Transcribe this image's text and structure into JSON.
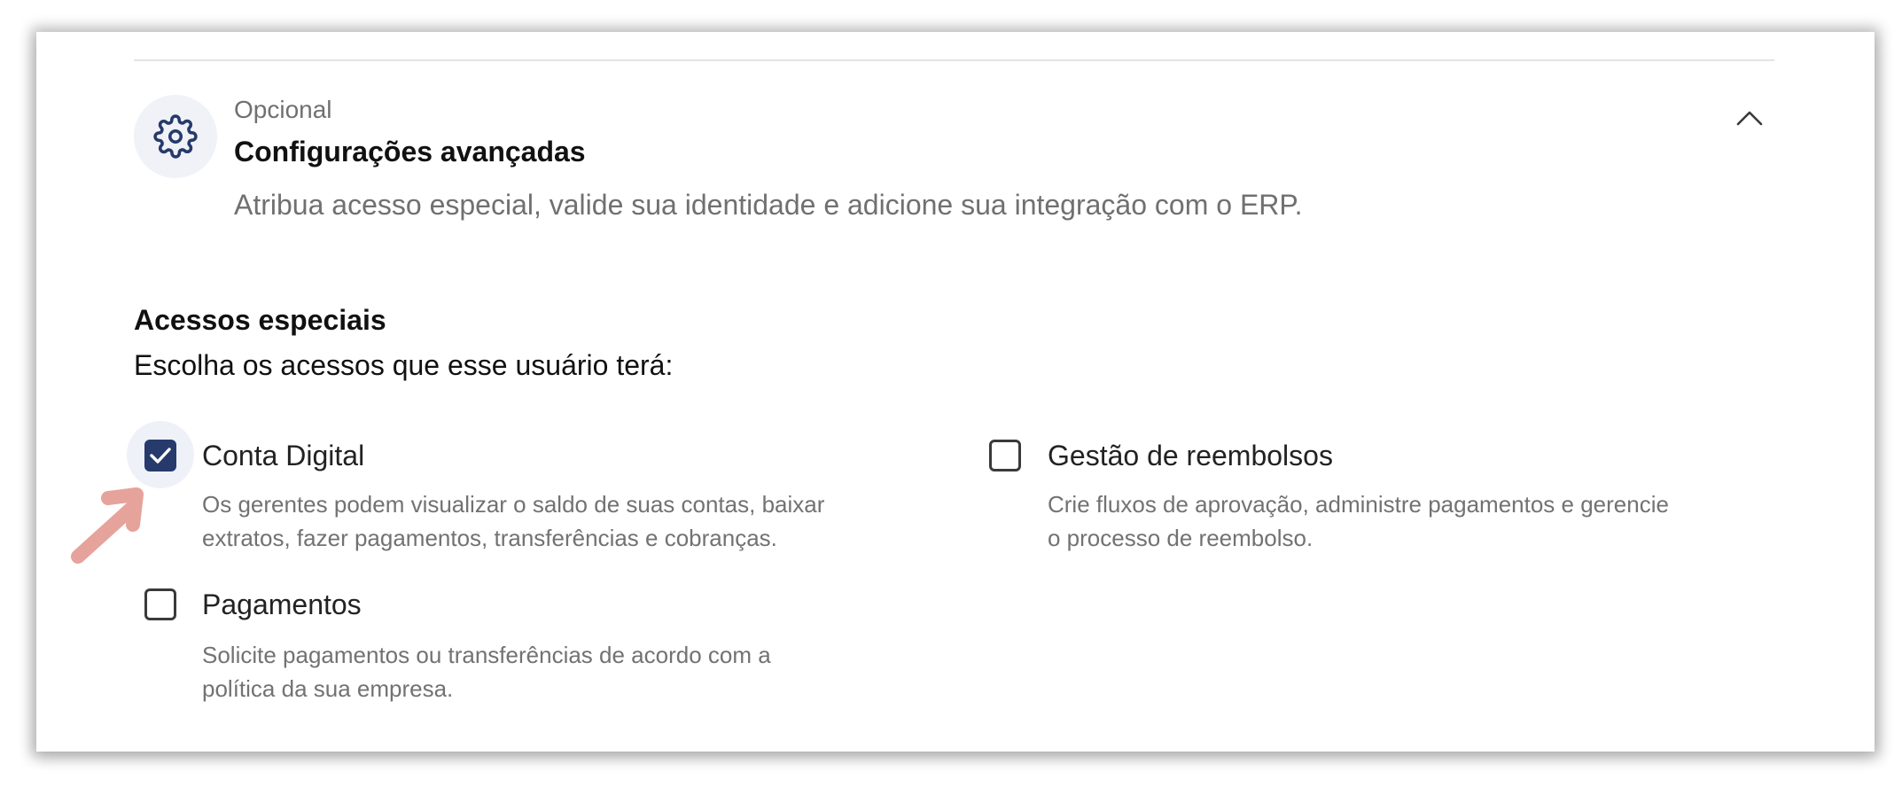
{
  "section": {
    "optional_label": "Opcional",
    "title": "Configurações avançadas",
    "description": "Atribua acesso especial, valide sua identidade e adicione sua integração com o ERP.",
    "icon": "gear-icon",
    "collapse_icon": "chevron-up-icon"
  },
  "access": {
    "title": "Acessos especiais",
    "subtitle": "Escolha os acessos que esse usuário terá:",
    "options": [
      {
        "label": "Conta Digital",
        "checked": true,
        "desc_line1": "Os gerentes podem visualizar o saldo de suas contas, baixar",
        "desc_line2": "extratos, fazer pagamentos, transferências e cobranças."
      },
      {
        "label": "Gestão de reembolsos",
        "checked": false,
        "desc_line1": "Crie fluxos de aprovação, administre pagamentos e gerencie",
        "desc_line2": "o processo de reembolso."
      },
      {
        "label": "Pagamentos",
        "checked": false,
        "desc_line1": "Solicite pagamentos ou transferências de acordo com a",
        "desc_line2": "política da sua empresa."
      }
    ]
  },
  "colors": {
    "accent": "#263a6b",
    "icon_bg": "#f0f2f8",
    "arrow": "#e6a39b",
    "muted_text": "#707070"
  }
}
